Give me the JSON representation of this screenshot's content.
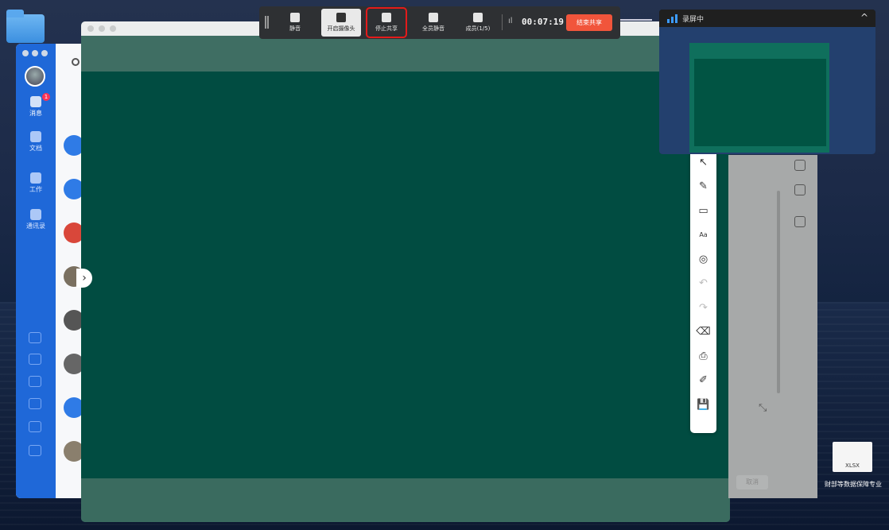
{
  "meeting_bar": {
    "buttons": [
      {
        "label": "静音",
        "icon": "mic-icon"
      },
      {
        "label": "开启摄像头",
        "icon": "camera-icon"
      },
      {
        "label": "停止共享",
        "icon": "screen-share-icon"
      },
      {
        "label": "全员静音",
        "icon": "mute-all-icon"
      },
      {
        "label": "成员(1/5)",
        "icon": "members-icon"
      }
    ],
    "timer": "00:07:19",
    "signal_glyph": "ıl",
    "end_share_label": "结束共享"
  },
  "preview": {
    "title": "录屏中",
    "chevron": "^"
  },
  "sidebar": {
    "items": [
      {
        "label": "消息",
        "icon": "chat-icon"
      },
      {
        "label": "文档",
        "icon": "doc-icon"
      },
      {
        "label": "工作",
        "icon": "apps-icon"
      },
      {
        "label": "通讯录",
        "icon": "contacts-icon"
      }
    ],
    "badge_count": "1"
  },
  "annotation_toolbar": {
    "tools": [
      {
        "icon": "pointer-icon",
        "glyph": "↖"
      },
      {
        "icon": "pen-icon",
        "glyph": "✎"
      },
      {
        "icon": "shapes-icon",
        "glyph": "▭"
      },
      {
        "icon": "text-icon",
        "glyph": "Aa"
      },
      {
        "icon": "laser-icon",
        "glyph": "◎"
      },
      {
        "icon": "undo-icon",
        "glyph": "↶"
      },
      {
        "icon": "redo-icon",
        "glyph": "↷"
      },
      {
        "icon": "eraser-icon",
        "glyph": "⌫"
      },
      {
        "icon": "stamp-icon",
        "glyph": "⎙"
      },
      {
        "icon": "edit-icon",
        "glyph": "✐"
      },
      {
        "icon": "save-icon",
        "glyph": "💾"
      }
    ]
  },
  "right_panel": {
    "cancel_label": "取消"
  },
  "desktop": {
    "file_type": "XLSX",
    "file_label": "财部等数据保障专业"
  },
  "colors": {
    "board": "#014c41",
    "end_button": "#f1553b",
    "highlight": "#e41b1b",
    "sidebar": "#1f68d8"
  }
}
